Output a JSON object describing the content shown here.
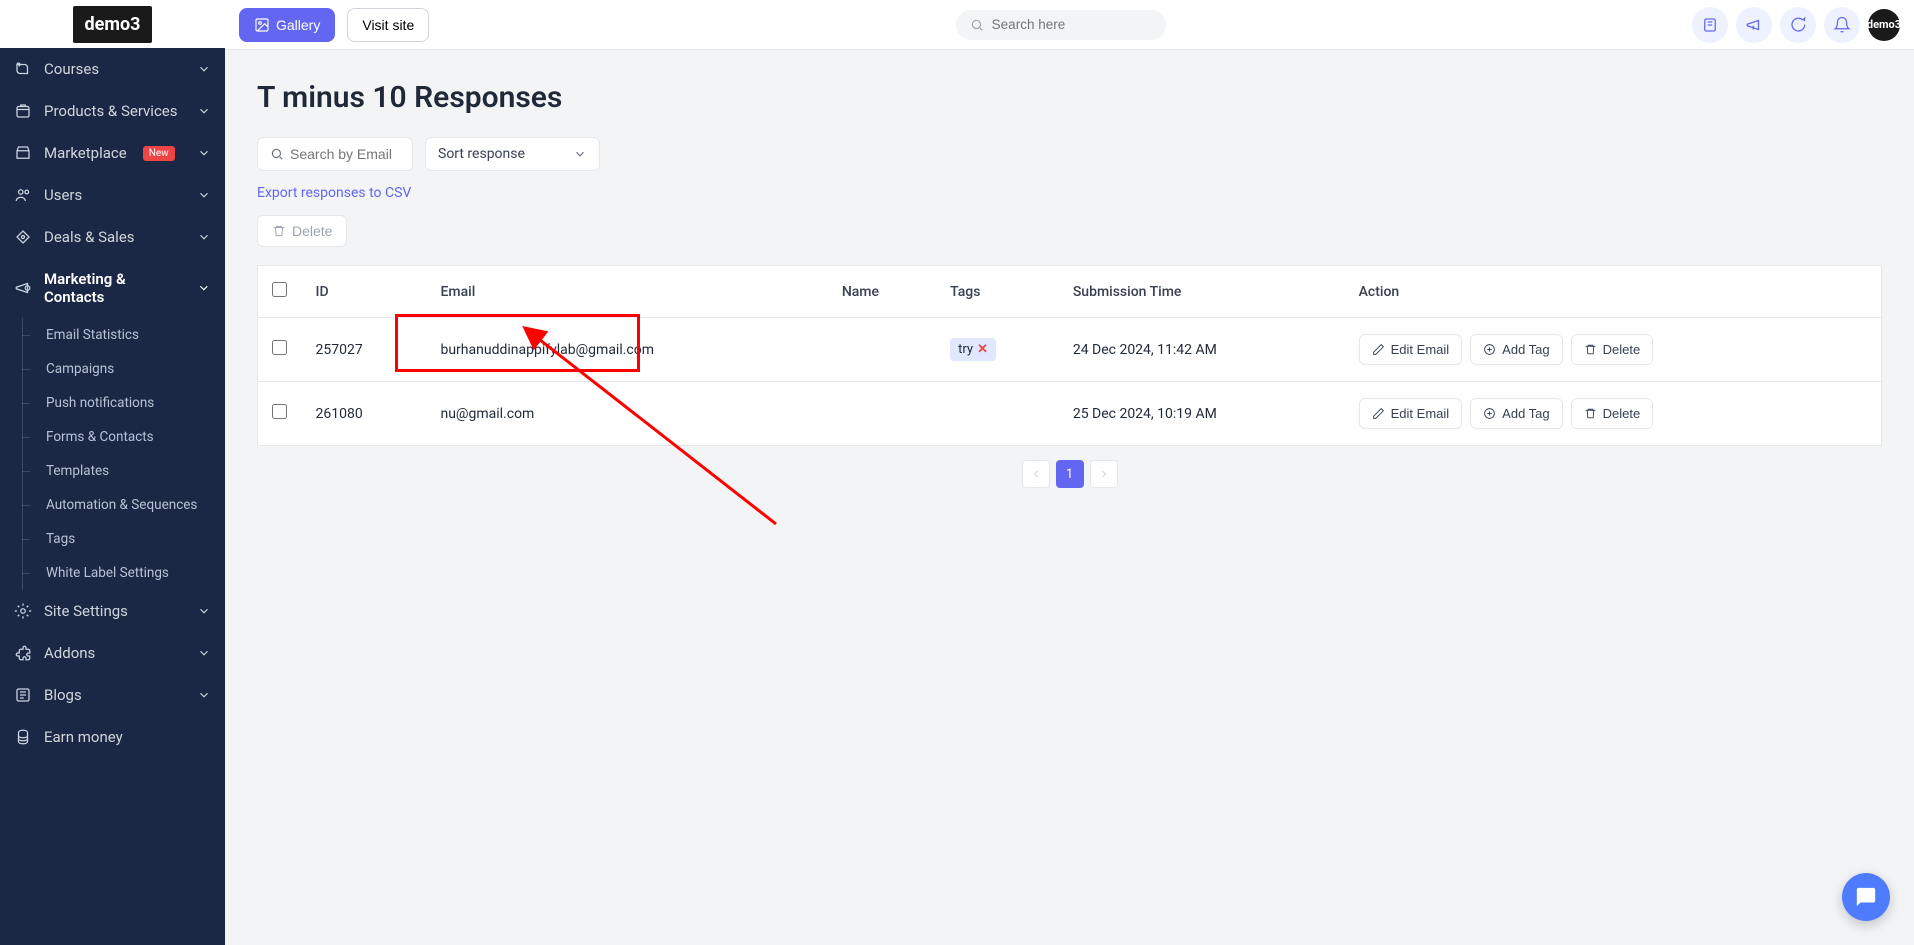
{
  "logo": "demo3",
  "header": {
    "gallery_label": "Gallery",
    "visit_label": "Visit site",
    "search_placeholder": "Search here",
    "avatar_text": "demo3"
  },
  "sidebar": {
    "items": [
      {
        "label": "Courses"
      },
      {
        "label": "Products & Services"
      },
      {
        "label": "Marketplace",
        "badge": "New"
      },
      {
        "label": "Users"
      },
      {
        "label": "Deals & Sales"
      },
      {
        "label": "Marketing & Contacts",
        "active": true
      },
      {
        "label": "Site Settings"
      },
      {
        "label": "Addons"
      },
      {
        "label": "Blogs"
      },
      {
        "label": "Earn money",
        "no_chev": true
      }
    ],
    "sub": [
      {
        "label": "Email Statistics"
      },
      {
        "label": "Campaigns"
      },
      {
        "label": "Push notifications"
      },
      {
        "label": "Forms & Contacts"
      },
      {
        "label": "Templates"
      },
      {
        "label": "Automation & Sequences"
      },
      {
        "label": "Tags"
      },
      {
        "label": "White Label Settings"
      }
    ]
  },
  "page": {
    "title": "T minus 10 Responses",
    "search_placeholder": "Search by Email",
    "sort_label": "Sort response",
    "export_label": "Export responses to CSV",
    "delete_label": "Delete"
  },
  "table": {
    "headers": {
      "id": "ID",
      "email": "Email",
      "name": "Name",
      "tags": "Tags",
      "time": "Submission Time",
      "action": "Action"
    },
    "rows": [
      {
        "id": "257027",
        "email": "burhanuddinappifylab@gmail.com",
        "name": "",
        "tags": [
          "try"
        ],
        "time": "24 Dec 2024, 11:42 AM"
      },
      {
        "id": "261080",
        "email": "nu@gmail.com",
        "name": "",
        "tags": [],
        "time": "25 Dec 2024, 10:19 AM"
      }
    ],
    "actions": {
      "edit": "Edit Email",
      "add_tag": "Add Tag",
      "delete": "Delete"
    }
  },
  "pagination": {
    "current": "1"
  }
}
